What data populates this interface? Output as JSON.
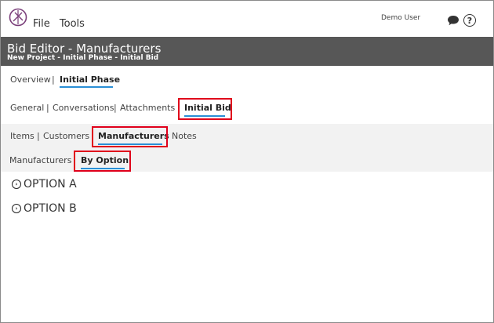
{
  "app": {
    "menu": [
      "File",
      "Tools"
    ],
    "user": "Demo User"
  },
  "header": {
    "title": "Bid Editor - Manufacturers",
    "breadcrumb": "New Project - Initial Phase - Initial Bid"
  },
  "tabs_level1": {
    "overview": "Overview",
    "initial_phase": "Initial Phase"
  },
  "tabs_level2": {
    "general": "General",
    "conversations": "Conversations",
    "attachments": "Attachments",
    "initial_bid": "Initial Bid"
  },
  "tabs_level3": {
    "items": "Items",
    "customers": "Customers",
    "manufacturers": "Manufacturers",
    "notes": "Notes"
  },
  "tabs_level4": {
    "manufacturers": "Manufacturers",
    "by_option": "By Option"
  },
  "options": [
    "OPTION A",
    "OPTION B"
  ],
  "separator": "|",
  "colors": {
    "titlebar": "#575757",
    "accent_underline": "#2a8fd6",
    "highlight_box": "#e0001b"
  },
  "icons": {
    "logo": "app-logo-icon",
    "chat": "chat-bubble-icon",
    "help": "help-circle-icon",
    "expand": "chevron-right-circle-icon"
  },
  "help_glyph": "?",
  "chevron_glyph": "›"
}
